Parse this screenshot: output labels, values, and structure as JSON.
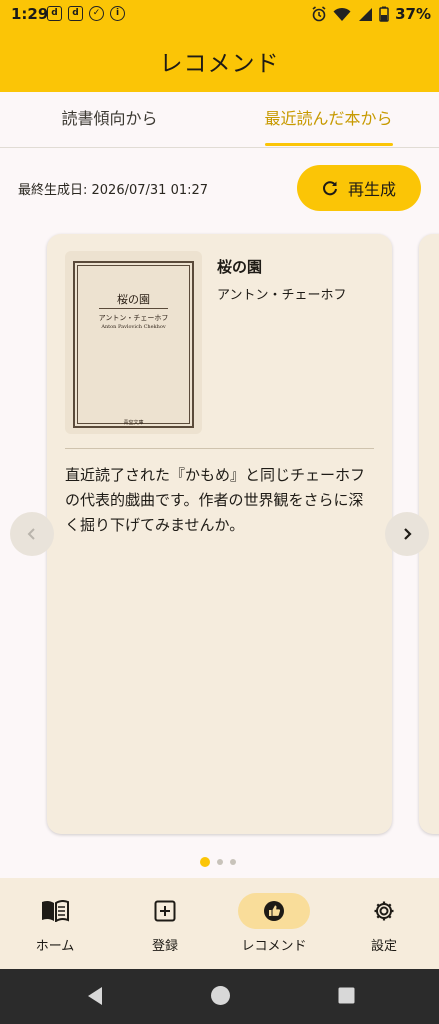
{
  "status_bar": {
    "time": "1:29",
    "notification_icons": [
      "d",
      "d",
      "check",
      "info"
    ],
    "battery": "37%"
  },
  "app_bar": {
    "title": "レコメンド"
  },
  "tabs": [
    {
      "label": "読書傾向から",
      "selected": false
    },
    {
      "label": "最近読んだ本から",
      "selected": true
    }
  ],
  "generation": {
    "label": "最終生成日: 2026/07/31 01:27",
    "regenerate_label": "再生成"
  },
  "recommendation": {
    "title": "桜の園",
    "author": "アントン・チェーホフ",
    "cover": {
      "title": "桜の園",
      "author": "アントン・チェーホフ",
      "roman": "Anton Pavlovich Chekhov",
      "publisher": "青空文庫"
    },
    "reason": "直近読了された『かもめ』と同じチェーホフの代表的戯曲です。作者の世界観をさらに深く掘り下げてみませんか。"
  },
  "carousel": {
    "pages": 3,
    "current": 1
  },
  "bottom_nav": [
    {
      "label": "ホーム",
      "icon": "book-open-icon",
      "active": false
    },
    {
      "label": "登録",
      "icon": "add-box-icon",
      "active": false
    },
    {
      "label": "レコメンド",
      "icon": "thumb-up-icon",
      "active": true
    },
    {
      "label": "設定",
      "icon": "gear-icon",
      "active": false
    }
  ],
  "colors": {
    "accent": "#FBC506",
    "accent_text": "#C79A00",
    "card_bg": "#F5ECDD",
    "nav_bg": "#F6ECDC"
  }
}
